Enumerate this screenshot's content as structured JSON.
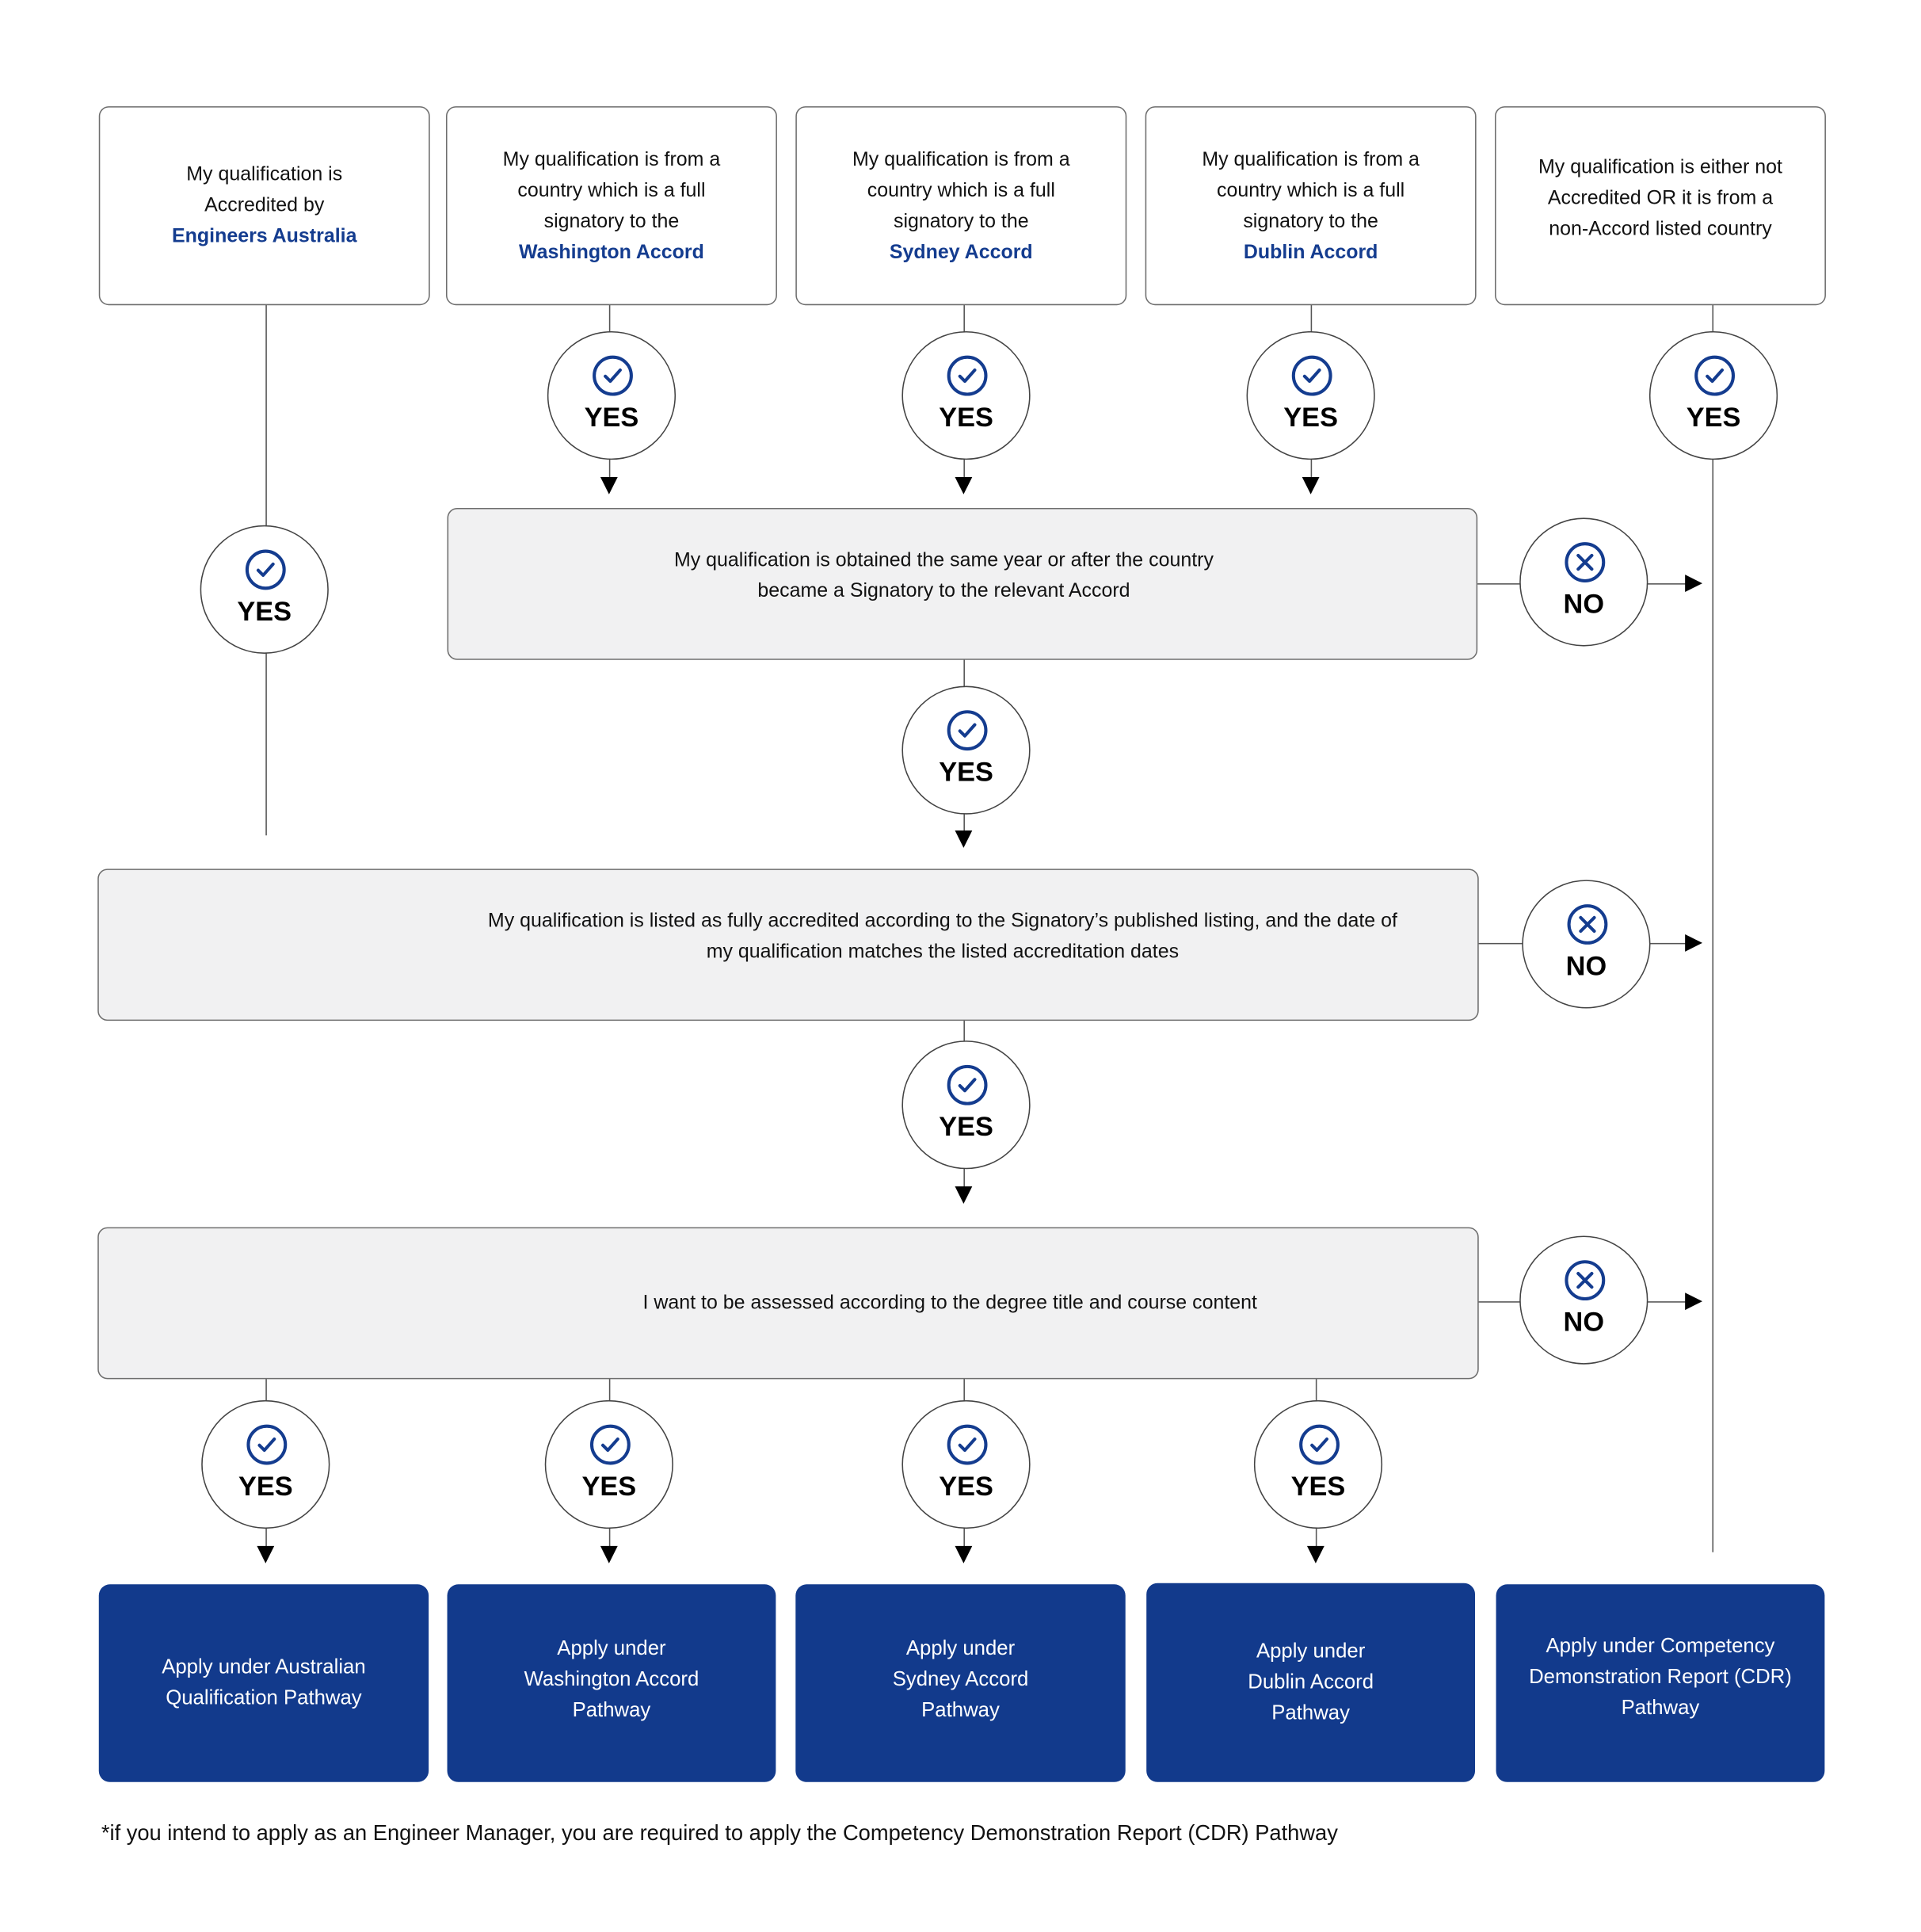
{
  "colors": {
    "accent": "#143c8f",
    "pathway_fill": "#123a8c",
    "decision_fill": "#f1f1f2"
  },
  "top_boxes": [
    {
      "text": "My qualification is Accredited by",
      "highlight": "Engineers Australia"
    },
    {
      "text": "My qualification is from a country which is a full signatory to the",
      "highlight": "Washington Accord"
    },
    {
      "text": "My qualification is from a country which is a full signatory to the",
      "highlight": "Sydney Accord"
    },
    {
      "text": "My qualification is from a country which is a full signatory to the",
      "highlight": "Dublin Accord"
    },
    {
      "text": "My qualification is either not Accredited OR it is from a non-Accord listed country",
      "highlight": ""
    }
  ],
  "decisions": [
    {
      "text": "My qualification is obtained the same year or after the country became a Signatory to the relevant Accord"
    },
    {
      "text": "My qualification is listed as fully accredited according to the Signatory’s published listing, and the date of my qualification matches the listed accreditation dates"
    },
    {
      "text": "I want to be assessed according to the degree title and course content"
    }
  ],
  "labels": {
    "yes": "YES",
    "no": "NO",
    "yes_icon": "check-circle-icon",
    "no_icon": "x-circle-icon"
  },
  "pathways": [
    {
      "text": "Apply under Australian Qualification Pathway"
    },
    {
      "text": "Apply under Washington Accord Pathway"
    },
    {
      "text": "Apply under Sydney Accord Pathway"
    },
    {
      "text": "Apply under Dublin Accord Pathway"
    },
    {
      "text": "Apply under Competency Demonstration Report (CDR) Pathway"
    }
  ],
  "footnote": "*if you intend to apply as an Engineer Manager, you are required to apply the Competency Demonstration Report (CDR) Pathway"
}
